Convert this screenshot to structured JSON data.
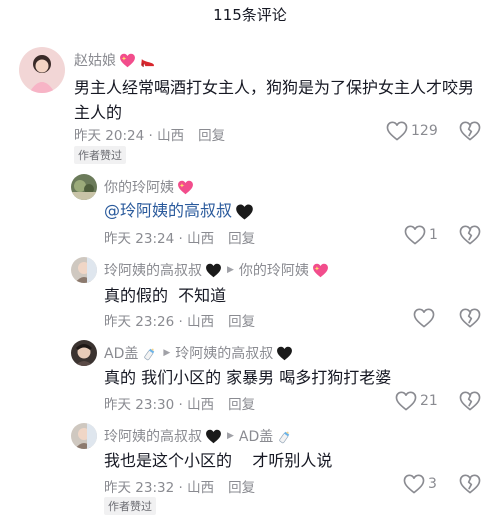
{
  "header": {
    "title": "115条评论"
  },
  "comments": [
    {
      "author": "赵姑娘",
      "text": "男主人经常喝酒打女主人，狗狗是为了保护女主人才咬男主人的",
      "time": "昨天 20:24 · 山西",
      "reply_label": "回复",
      "likes": "129",
      "badge": "作者赞过"
    },
    {
      "author": "你的玲阿姨",
      "mention": "@玲阿姨的高叔叔",
      "time": "昨天 23:24 · 山西",
      "reply_label": "回复",
      "likes": "1"
    },
    {
      "author": "玲阿姨的高叔叔",
      "reply_to": "你的玲阿姨",
      "text": "真的假的  不知道",
      "time": "昨天 23:26 · 山西",
      "reply_label": "回复",
      "likes": ""
    },
    {
      "author": "AD盖",
      "reply_to": "玲阿姨的高叔叔",
      "text": "真的 我们小区的 家暴男 喝多打狗打老婆",
      "time": "昨天 23:30 · 山西",
      "reply_label": "回复",
      "likes": "21"
    },
    {
      "author": "玲阿姨的高叔叔",
      "reply_to": "AD盖",
      "text": "我也是这个小区的    才听别人说",
      "time": "昨天 23:32 · 山西",
      "reply_label": "回复",
      "likes": "3",
      "badge": "作者赞过"
    }
  ],
  "icons": {
    "like": "heart-outline-icon",
    "dislike": "broken-heart-icon",
    "reply_arrow": "triangle-right-icon",
    "emoji_heart": "sparkling-heart-emoji",
    "emoji_shoe": "high-heel-emoji",
    "emoji_black_heart": "black-heart-emoji",
    "emoji_bottle": "baby-bottle-emoji"
  }
}
